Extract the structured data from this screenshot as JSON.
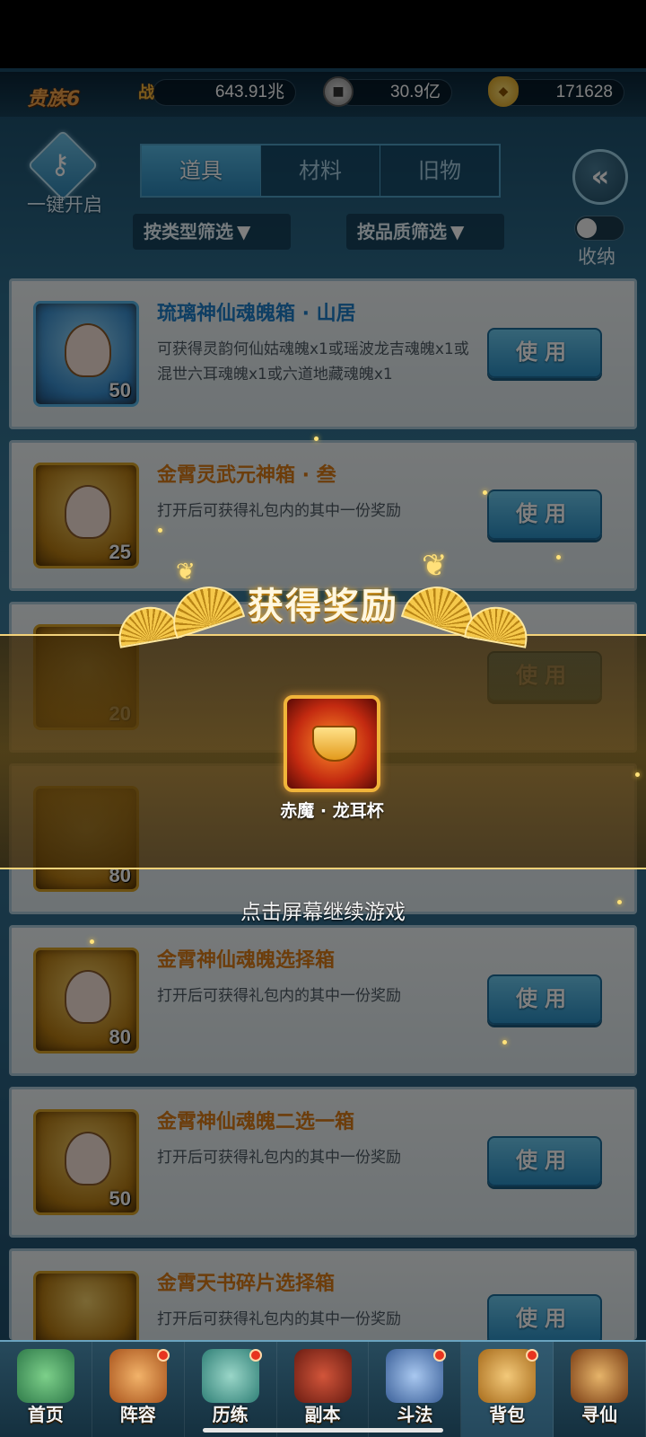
{
  "resources": {
    "noble_label": "贵族6",
    "power_icon": "战",
    "power_value": "643.91兆",
    "silver_value": "30.9亿",
    "gold_value": "171628"
  },
  "toolbar": {
    "one_click_label": "一键开启",
    "tabs": [
      "道具",
      "材料",
      "旧物"
    ],
    "active_tab": "道具",
    "filter_type_label": "按类型筛选",
    "filter_quality_label": "按品质筛选",
    "collect_label": "收纳"
  },
  "items": [
    {
      "title": "琉璃神仙魂魄箱 · 山居",
      "desc": "可获得灵韵何仙姑魂魄x1或瑶波龙吉魂魄x1或混世六耳魂魄x1或六道地藏魂魄x1",
      "count": "50",
      "button": "使用"
    },
    {
      "title": "金霄灵武元神箱 · 叁",
      "desc": "打开后可获得礼包内的其中一份奖励",
      "count": "25",
      "button": "使用"
    },
    {
      "title": "",
      "desc": "",
      "count": "20",
      "button": "使用"
    },
    {
      "title": "",
      "desc": "",
      "count": "80",
      "button": "使用"
    },
    {
      "title": "金霄神仙魂魄选择箱",
      "desc": "打开后可获得礼包内的其中一份奖励",
      "count": "80",
      "button": "使用"
    },
    {
      "title": "金霄神仙魂魄二选一箱",
      "desc": "打开后可获得礼包内的其中一份奖励",
      "count": "50",
      "button": "使用"
    },
    {
      "title": "金霄天书碎片选择箱",
      "desc": "打开后可获得礼包内的其中一份奖励",
      "count": "",
      "button": "使用"
    }
  ],
  "reward": {
    "title": "获得奖励",
    "item_name": "赤魔 · 龙耳杯",
    "continue_tip": "点击屏幕继续游戏"
  },
  "nav": [
    {
      "label": "首页",
      "has_dot": false
    },
    {
      "label": "阵容",
      "has_dot": true
    },
    {
      "label": "历练",
      "has_dot": true
    },
    {
      "label": "副本",
      "has_dot": false
    },
    {
      "label": "斗法",
      "has_dot": true
    },
    {
      "label": "背包",
      "has_dot": true
    },
    {
      "label": "寻仙",
      "has_dot": false
    }
  ],
  "colors": {
    "accent_blue": "#2b8fc4",
    "gold": "#f3d27a",
    "title_orange": "#d87a16",
    "title_blue": "#1d7cc6"
  }
}
